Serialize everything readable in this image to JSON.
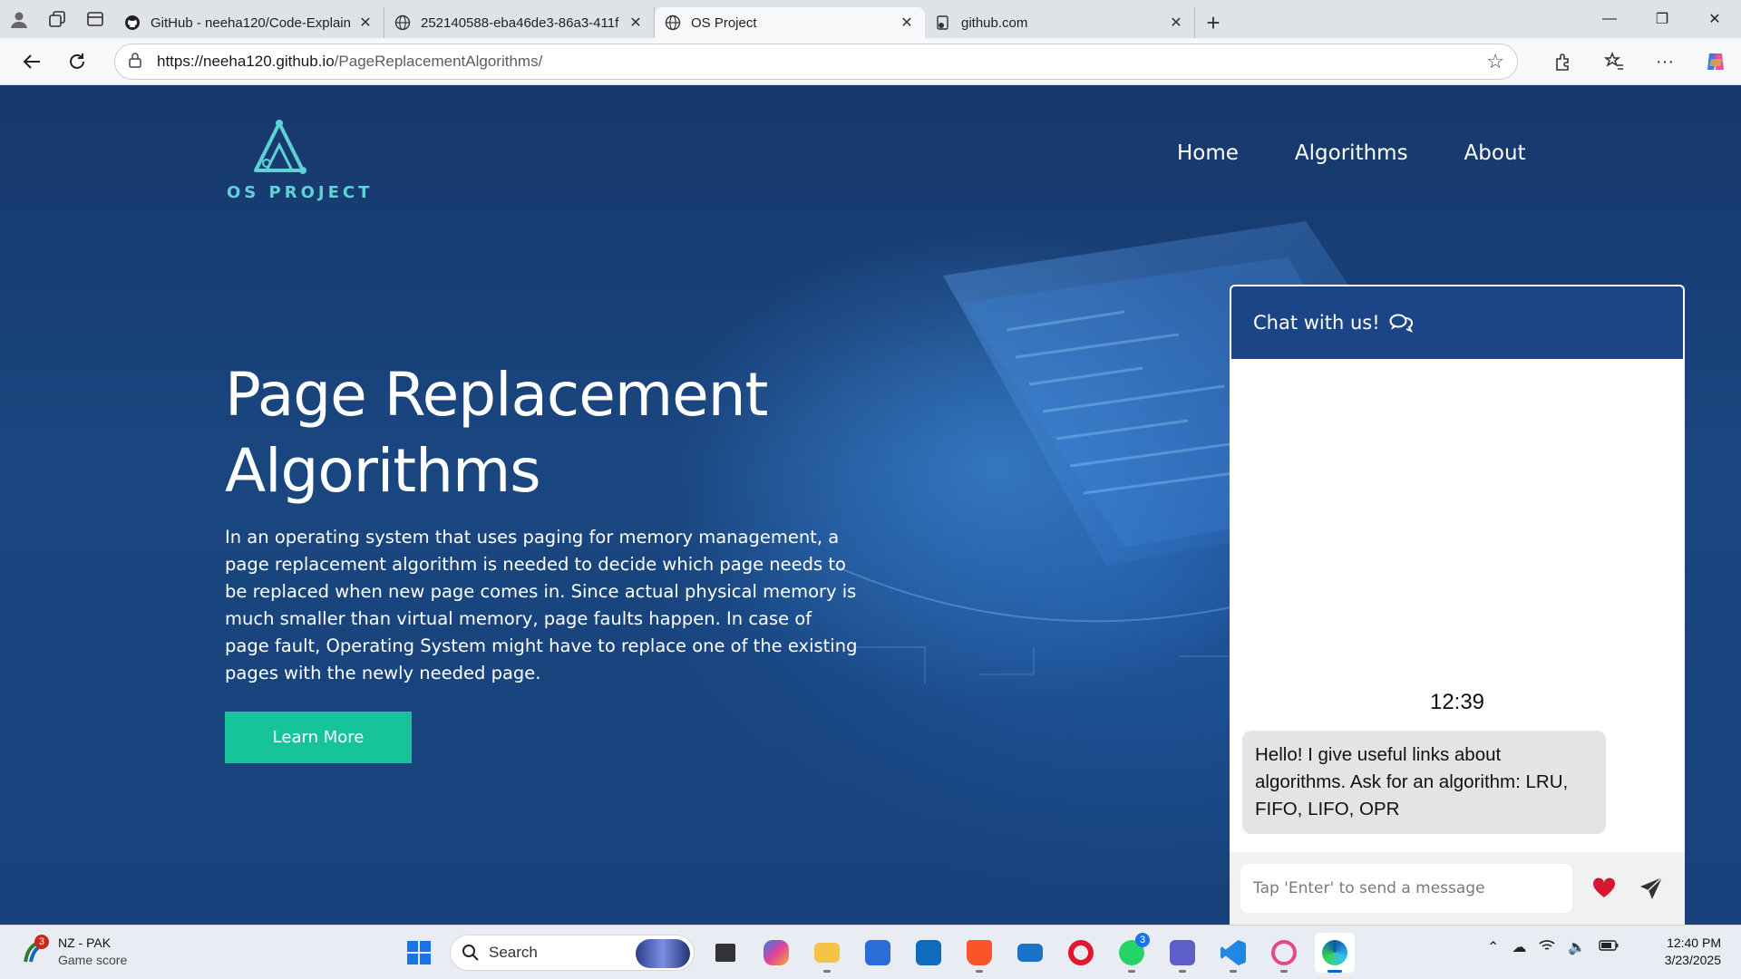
{
  "browser": {
    "tabs": [
      {
        "label": "GitHub - neeha120/Code-Explain",
        "icon": "github-icon",
        "active": false
      },
      {
        "label": "252140588-eba46de3-86a3-411f",
        "icon": "globe-icon",
        "active": false
      },
      {
        "label": "OS Project",
        "icon": "globe-icon",
        "active": true
      },
      {
        "label": "github.com",
        "icon": "page-icon",
        "active": false
      }
    ],
    "url_host": "https://neeha120.github.io",
    "url_path": "/PageReplacementAlgorithms/"
  },
  "site": {
    "logo_text": "OS PROJECT",
    "nav": [
      "Home",
      "Algorithms",
      "About"
    ],
    "hero_title_line1": "Page Replacement",
    "hero_title_line2": "Algorithms",
    "hero_description": "In an operating system that uses paging for memory management, a page replacement algorithm is needed to decide which page needs to be replaced when new page comes in. Since actual physical memory is much smaller than virtual memory, page faults happen. In case of page fault, Operating System might have to replace one of the existing pages with the newly needed page.",
    "learn_more": "Learn More",
    "accent_color": "#17c39b"
  },
  "chat": {
    "title": "Chat with us!",
    "time": "12:39",
    "message": "Hello! I give useful links about algorithms. Ask for an algorithm: LRU, FIFO, LIFO, OPR",
    "input_placeholder": "Tap 'Enter' to send a message",
    "header_color": "#1c4587"
  },
  "taskbar": {
    "weather_title": "NZ - PAK",
    "weather_sub": "Game score",
    "weather_badge": "3",
    "search_label": "Search",
    "whatsapp_badge": "3",
    "time": "12:40 PM",
    "date": "3/23/2025"
  }
}
